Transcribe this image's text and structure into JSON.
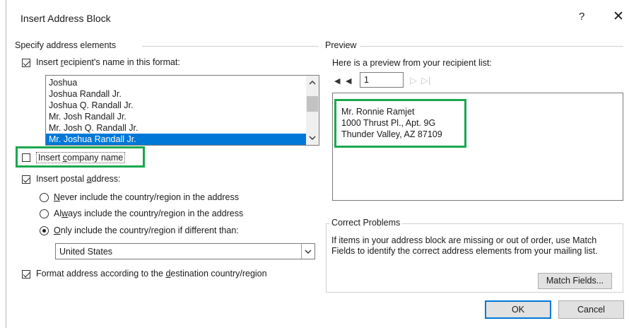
{
  "dialog": {
    "title": "Insert Address Block",
    "help_label": "?",
    "close_label": "✕"
  },
  "left": {
    "section_label": "Specify address elements",
    "insert_name": {
      "pre": "Insert ",
      "u": "r",
      "post": "ecipient's name in this format:",
      "checked": true
    },
    "name_formats": [
      "Joshua",
      "Joshua Randall Jr.",
      "Joshua Q. Randall Jr.",
      "Mr. Josh Randall Jr.",
      "Mr. Josh Q. Randall Jr.",
      "Mr. Joshua Randall Jr."
    ],
    "selected_format_index": 5,
    "insert_company": {
      "pre": "Insert ",
      "u": "c",
      "post": "ompany name",
      "checked": false
    },
    "insert_postal": {
      "pre": "Insert postal ",
      "u": "a",
      "post": "ddress:",
      "checked": true
    },
    "radio_never": {
      "pre": "",
      "u": "N",
      "post": "ever include the country/region in the address"
    },
    "radio_always": {
      "pre": "Al",
      "u": "w",
      "post": "ays include the country/region in the address"
    },
    "radio_only": {
      "pre": "",
      "u": "O",
      "post": "nly include the country/region if different than:"
    },
    "country_value": "United States",
    "format_destination": {
      "pre": "Format address according to the ",
      "u": "d",
      "post": "estination country/region",
      "checked": true
    }
  },
  "right": {
    "section_label": "Preview",
    "preview_caption": "Here is a preview from your recipient list:",
    "record_number": "1",
    "address_lines": [
      "Mr. Ronnie Ramjet",
      "1000 Thrust Pl., Apt. 9G",
      "Thunder Valley, AZ 87109"
    ],
    "problems_label": "Correct Problems",
    "problems_text": "If items in your address block are missing or out of order, use Match Fields to identify the correct address elements from your mailing list.",
    "match_fields_label": "Match Fields..."
  },
  "footer": {
    "ok_label": "OK",
    "cancel_label": "Cancel"
  },
  "colors": {
    "accent": "#0078d7",
    "highlight": "#1aa84e"
  }
}
